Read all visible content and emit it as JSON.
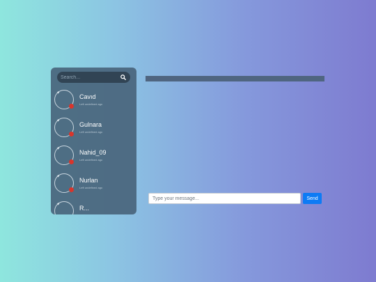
{
  "sidebar": {
    "search": {
      "placeholder": "Search...",
      "icon": "search-icon"
    },
    "contacts": [
      {
        "name": "Cavıd",
        "status": "Left undefined ago",
        "online_indicator_color": "#d9352b"
      },
      {
        "name": "Gulnara",
        "status": "Left undefined ago",
        "online_indicator_color": "#d9352b"
      },
      {
        "name": "Nahid_09",
        "status": "Left undefined ago",
        "online_indicator_color": "#d9352b"
      },
      {
        "name": "Nurlan",
        "status": "Left undefined ago",
        "online_indicator_color": "#d9352b"
      },
      {
        "name": "R...",
        "status": "",
        "online_indicator_color": "#d9352b"
      }
    ]
  },
  "chat": {
    "header_color": "#4f6580",
    "message_input": {
      "placeholder": "Type your message...",
      "value": ""
    },
    "send_label": "Send",
    "send_color": "#0d7bf5"
  }
}
